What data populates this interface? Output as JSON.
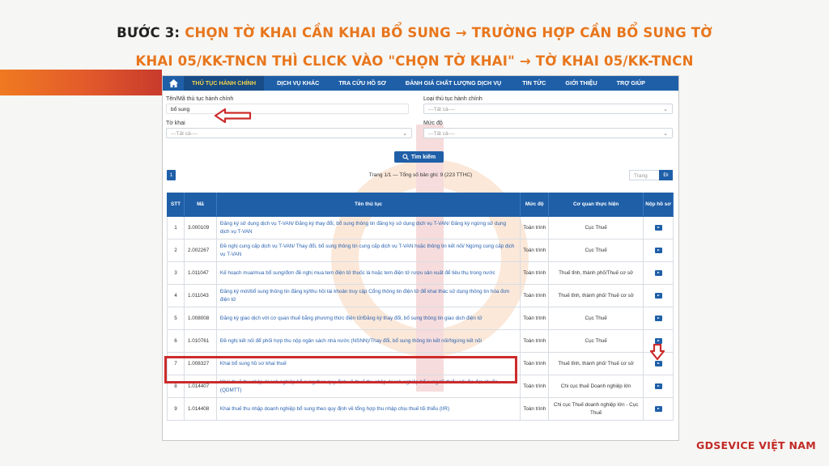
{
  "heading": {
    "line1_prefix": "BƯỚC 3: ",
    "line1_highlight": "CHỌN TỜ KHAI CẦN KHAI BỔ SUNG → TRƯỜNG HỢP CẦN BỔ SUNG TỜ",
    "line2": "KHAI 05/KK-TNCN THÌ CLICK VÀO \"CHỌN TỜ KHAI\" → TỜ KHAI 05/KK-TNCN"
  },
  "brand": "GDSEVICE VIỆT NAM",
  "colors": {
    "accent": "#e8761c",
    "primary": "#1f5fa8",
    "highlight": "#cc2b2b"
  },
  "nav": {
    "home_icon": "home-icon",
    "items": [
      {
        "label": "THỦ TỤC HÀNH CHÍNH",
        "active": true
      },
      {
        "label": "DỊCH VỤ KHÁC"
      },
      {
        "label": "TRA CỨU HỒ SƠ"
      },
      {
        "label": "ĐÁNH GIÁ CHẤT LƯỢNG DỊCH VỤ"
      },
      {
        "label": "TIN TỨC"
      },
      {
        "label": "GIỚI THIỆU"
      },
      {
        "label": "TRỢ GIÚP"
      }
    ]
  },
  "form": {
    "name_label": "Tên/Mã thủ tục hành chính",
    "name_value": "bổ sung",
    "type_label": "Loại thủ tục hành chính",
    "type_value": "---Tất cả----",
    "form_label": "Tờ khai",
    "form_value": "---Tất cả----",
    "level_label": "Mức độ",
    "level_value": "---Tất cả----",
    "search_label": "Tìm kiếm"
  },
  "pager": {
    "current_page": "1",
    "info": "Trang 1/1 — Tổng số bản ghi: 9 (223 TTHC)",
    "goto_placeholder": "Trang",
    "goto_button": "Đi"
  },
  "table": {
    "headers": [
      "STT",
      "Mã",
      "Tên thủ tục",
      "Mức độ",
      "Cơ quan thực hiện",
      "Nộp hồ sơ"
    ],
    "rows": [
      {
        "stt": "1",
        "ma": "3.000109",
        "name": "Đăng ký sử dụng dịch vụ T-VAN/ Đăng ký thay đổi, bổ sung thông tin đăng ký sử dụng dịch vụ T-VAN/ Đăng ký ngừng sử dụng dịch vụ T-VAN",
        "level": "Toàn trình",
        "agency": "Cục Thuế"
      },
      {
        "stt": "2",
        "ma": "2.002267",
        "name": "Đề nghị cung cấp dịch vụ T-VAN/ Thay đổi, bổ sung thông tin cung cấp dịch vụ T-VAN hoặc thông tin kết nối/ Ngừng cung cấp dịch vụ T-VAN",
        "level": "Toàn trình",
        "agency": "Cục Thuế"
      },
      {
        "stt": "3",
        "ma": "1.011047",
        "name": "Kế hoạch mua/mua bổ sung/đơn đề nghị mua tem điện tử thuốc lá hoặc tem điện tử rượu sản xuất để tiêu thụ trong nước",
        "level": "Toàn trình",
        "agency": "Thuế tỉnh, thành phố/Thuế cơ sở"
      },
      {
        "stt": "4",
        "ma": "1.011043",
        "name": "Đăng ký mới/bổ sung thông tin đăng ký/thu hồi tài khoản truy cập Cổng thông tin điện tử để khai thác sử dụng thông tin hóa đơn điện tử",
        "level": "Toàn trình",
        "agency": "Thuế tỉnh, thành phố/ Thuế cơ sở"
      },
      {
        "stt": "5",
        "ma": "1.008008",
        "name": "Đăng ký giao dịch với cơ quan thuế bằng phương thức điện tử/Đăng ký thay đổi, bổ sung thông tin giao dịch điện tử",
        "level": "Toàn trình",
        "agency": "Cục Thuế"
      },
      {
        "stt": "6",
        "ma": "1.010761",
        "name": "Đề nghị kết nối để phối hợp thu nộp ngân sách nhà nước (NSNN)/Thay đổi, bổ sung thông tin kết nối/Ngừng kết nối",
        "level": "Toàn trình",
        "agency": "Cục Thuế"
      },
      {
        "stt": "7",
        "ma": "1.008327",
        "name": "Khai bổ sung hồ sơ khai thuế",
        "level": "Toàn trình",
        "agency": "Thuế tỉnh, thành phố/ Thuế cơ sở"
      },
      {
        "stt": "8",
        "ma": "1.014407",
        "name": "Khai thuế thu nhập doanh nghiệp bổ sung theo quy định về thuế thu nhập doanh nghiệp bổ sung tối thiểu nội địa đạt chuẩn (QDMTT)",
        "level": "Toàn trình",
        "agency": "Chi cục thuế Doanh nghiệp lớn"
      },
      {
        "stt": "9",
        "ma": "1.014408",
        "name": "Khai thuế thu nhập doanh nghiệp bổ sung theo quy định về tổng hợp thu nhập chịu thuế tối thiểu (IIR)",
        "level": "Toàn trình",
        "agency": "Chi cục Thuế doanh nghiệp lớn - Cục Thuế"
      }
    ]
  }
}
